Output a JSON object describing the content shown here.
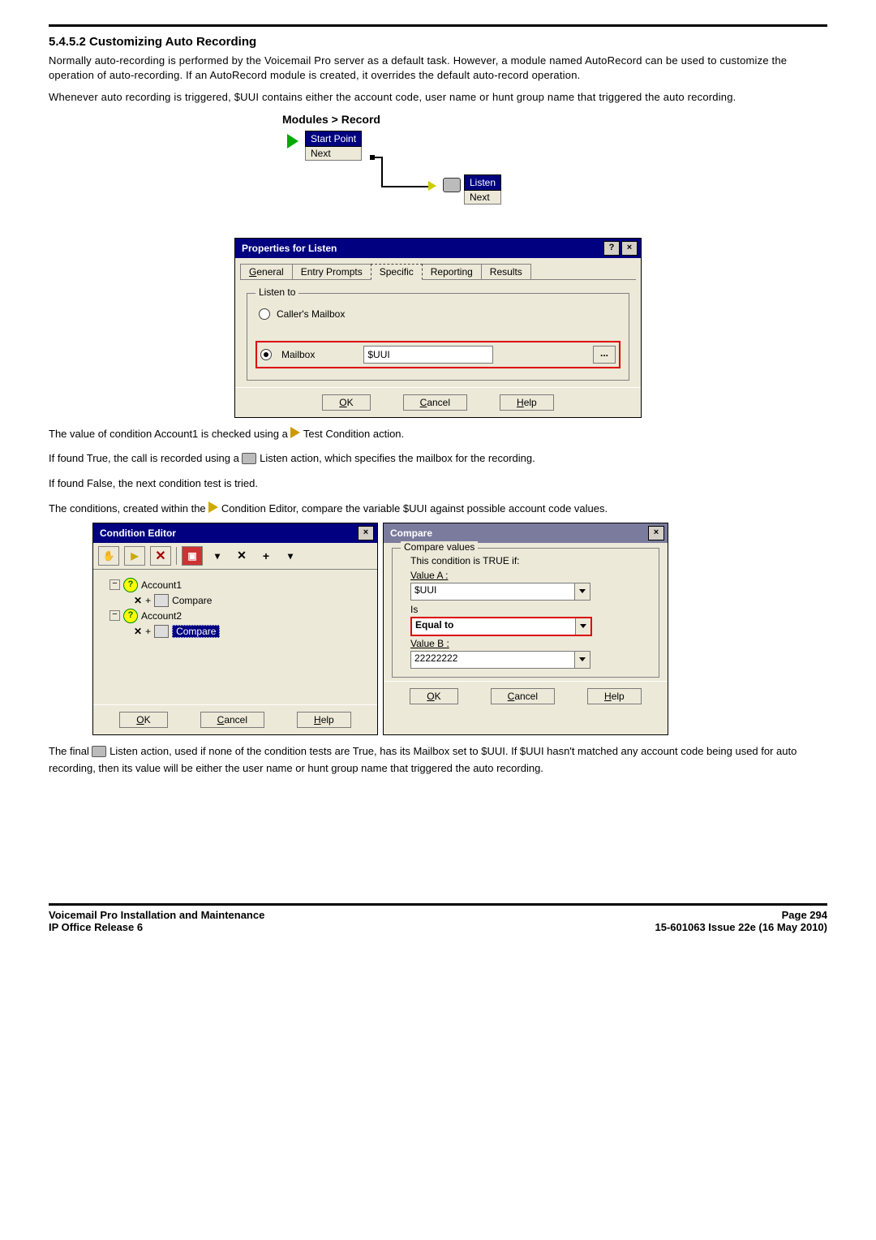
{
  "section_number": "5.4.5.2",
  "section_title": "Customizing Auto Recording",
  "para1": "Normally auto-recording is performed by the Voicemail Pro server as a default task. However, a module named AutoRecord can be used to customize the operation of auto-recording. If an AutoRecord module is created, it overrides the default auto-record operation.",
  "para2": "Whenever auto recording is triggered, $UUI contains either the account code, user name or hunt group name that triggered the auto recording.",
  "modules_title": "Modules > Record",
  "start_point": "Start Point",
  "next_label": "Next",
  "listen_label": "Listen",
  "props_dialog": {
    "title": "Properties for Listen",
    "tabs": [
      "General",
      "Entry Prompts",
      "Specific",
      "Reporting",
      "Results"
    ],
    "active_tab": "Specific",
    "group": "Listen to",
    "radio_callers": "Caller's Mailbox",
    "radio_mailbox": "Mailbox",
    "mailbox_value": "$UUI",
    "ok": "OK",
    "cancel": "Cancel",
    "help": "Help",
    "browse": "..."
  },
  "text_after_props_1a": "The value of condition Account1 is checked using a ",
  "text_after_props_1b": " Test Condition action.",
  "text_true_a": "If found True, the call is recorded using a  ",
  "text_true_b": " Listen action, which specifies the mailbox for the recording.",
  "text_false": "If found False, the next condition test is tried.",
  "text_cond_a": "The conditions, created within the ",
  "text_cond_b": " Condition Editor, compare the variable $UUI against possible account code values.",
  "cond_editor": {
    "title": "Condition Editor",
    "account1": "Account1",
    "account2": "Account2",
    "compare": "Compare",
    "ok": "OK",
    "cancel": "Cancel",
    "help": "Help"
  },
  "compare_dialog": {
    "title": "Compare",
    "group": "Compare values",
    "msg": "This condition is TRUE if:",
    "value_a": "Value A :",
    "value_a_val": "$UUI",
    "is": "Is",
    "operator": "Equal to",
    "value_b": "Value B :",
    "value_b_val": "22222222",
    "ok": "OK",
    "cancel": "Cancel",
    "help": "Help"
  },
  "final_para_a": "The final ",
  "final_para_b": " Listen action, used if none of the condition tests are True, has its Mailbox set to $UUI. If $UUI hasn't matched any account code being used for auto recording, then its value will be either the user name or hunt group name that triggered the auto recording.",
  "footer": {
    "left1": "Voicemail Pro Installation and Maintenance",
    "left2": "IP Office Release 6",
    "right1": "Page 294",
    "right2": "15-601063 Issue 22e (16 May 2010)"
  }
}
